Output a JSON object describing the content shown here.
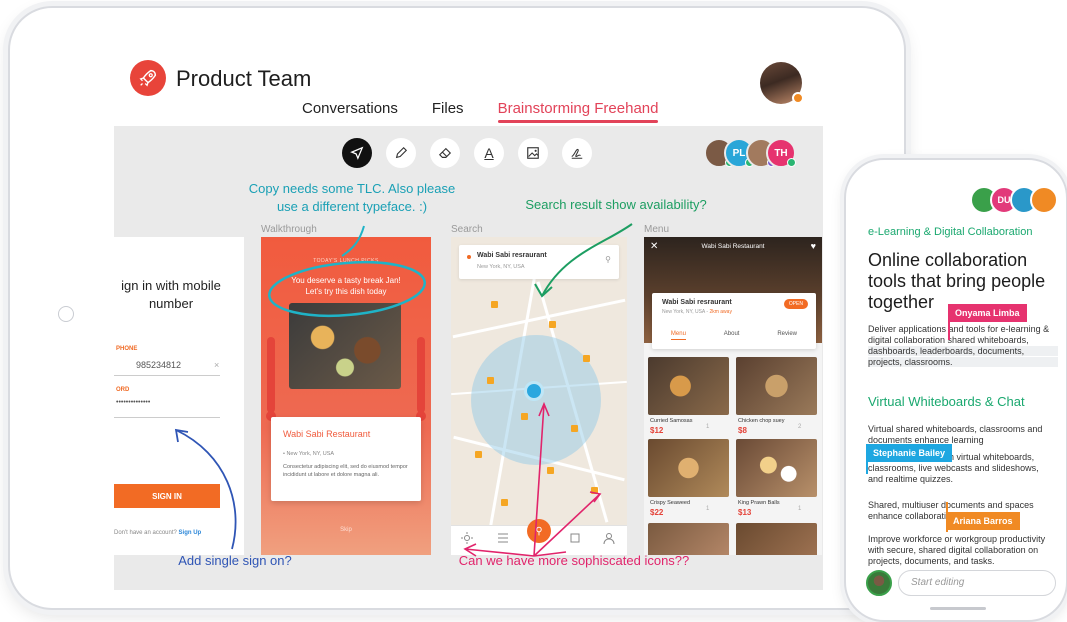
{
  "app": {
    "title": "Product Team",
    "tabs": [
      "Conversations",
      "Files",
      "Brainstorming Freehand"
    ],
    "active_tab": 2,
    "accent": "#e24359"
  },
  "toolbar": {
    "tools": [
      "pointer-icon",
      "pen-icon",
      "eraser-icon",
      "text-icon",
      "image-icon",
      "signature-icon"
    ],
    "text_tool_glyph": "A"
  },
  "collaborators": [
    {
      "initials": "",
      "color": "#7b5a45",
      "status": "#2bb673"
    },
    {
      "initials": "PL",
      "color": "#29a6d8",
      "status": "#2bb673"
    },
    {
      "initials": "",
      "color": "#a27a5e",
      "status": "#7a5bd0"
    },
    {
      "initials": "TH",
      "color": "#e6336f",
      "status": "#2bb673"
    }
  ],
  "frames": {
    "walkthrough_label": "Walkthrough",
    "search_label": "Search",
    "menu_label": "Menu"
  },
  "signin": {
    "title_line1": "ign in with mobile",
    "title_line2": "number",
    "phone_label": "PHONE",
    "phone_value": "985234812",
    "clear_glyph": "×",
    "password_label": "ORD",
    "password_value": "••••••••••••••",
    "button": "SIGN IN",
    "no_account": "Don't have an account?",
    "signup": "Sign Up"
  },
  "walkthrough": {
    "eyebrow": "TODAY'S LUNCH PICKS",
    "speech_line1": "You deserve a tasty break Jan!",
    "speech_line2": "Let's try this dish today",
    "restaurant": "Wabi Sabi Restaurant",
    "address": "• New York, NY, USA",
    "description": "Consectetur adipiscing elit, sed do eiusmod tempor incididunt ut labore et dolore magna ali.",
    "skip": "Skip"
  },
  "search": {
    "restaurant": "Wabi Sabi resraurant",
    "location": "New York, NY, USA",
    "tabbar_labels": [
      "Favorites",
      "Nearby",
      "",
      "List",
      "Profile"
    ]
  },
  "menu": {
    "header_title": "Wabi Sabi Restaurant",
    "restaurant": "Wabi Sabi resraurant",
    "address": "New York, NY, USA -",
    "distance": "2km away",
    "open_badge": "OPEN",
    "tabs": [
      "Menu",
      "About",
      "Review"
    ],
    "items": [
      {
        "name": "Curried Samosas",
        "price": "$12",
        "qty": "1"
      },
      {
        "name": "Chicken chop suey",
        "price": "$8",
        "qty": "2"
      },
      {
        "name": "Crispy Seaweed",
        "price": "$22",
        "qty": "1"
      },
      {
        "name": "King Prawn Balls",
        "price": "$13",
        "qty": "1"
      }
    ]
  },
  "annotations": {
    "typeface_line1": "Copy needs some TLC. Also please",
    "typeface_line2": "use a different typeface. :)",
    "availability": "Search result show availability?",
    "sso": "Add single sign on?",
    "icons": "Can we have more sophiscated icons??"
  },
  "phone": {
    "avatars": [
      {
        "initials": "",
        "color": "#3aa04a"
      },
      {
        "initials": "DU",
        "color": "#e23a7a"
      },
      {
        "initials": "",
        "color": "#2a98c9"
      },
      {
        "initials": "",
        "color": "#f08a24"
      }
    ],
    "eyebrow": "e-Learning & Digital Collaboration",
    "title": "Online collaboration tools that bring people together",
    "p1": "Deliver applications and tools for e-learning & digital collaboration shared whiteboards, dashboards, leaderboards, documents, projects, classrooms.",
    "subheading": "Virtual Whiteboards & Chat",
    "p2": "Virtual shared whiteboards, classrooms and documents enhance learning",
    "p3": "Engage students with virtual whiteboards, classrooms, live webcasts and slideshows, and realtime quizzes.",
    "p4": "Shared, multiuser documents and spaces enhance collaboration",
    "p5": "Improve workforce or workgroup productivity with secure, shared digital collaboration on projects, documents, and tasks.",
    "cursors": [
      {
        "name": "Onyama Limba",
        "color": "#e6336f"
      },
      {
        "name": "Stephanie Bailey",
        "color": "#1ea7e1"
      },
      {
        "name": "Ariana Barros",
        "color": "#f08a24"
      }
    ],
    "input_placeholder": "Start editing"
  }
}
